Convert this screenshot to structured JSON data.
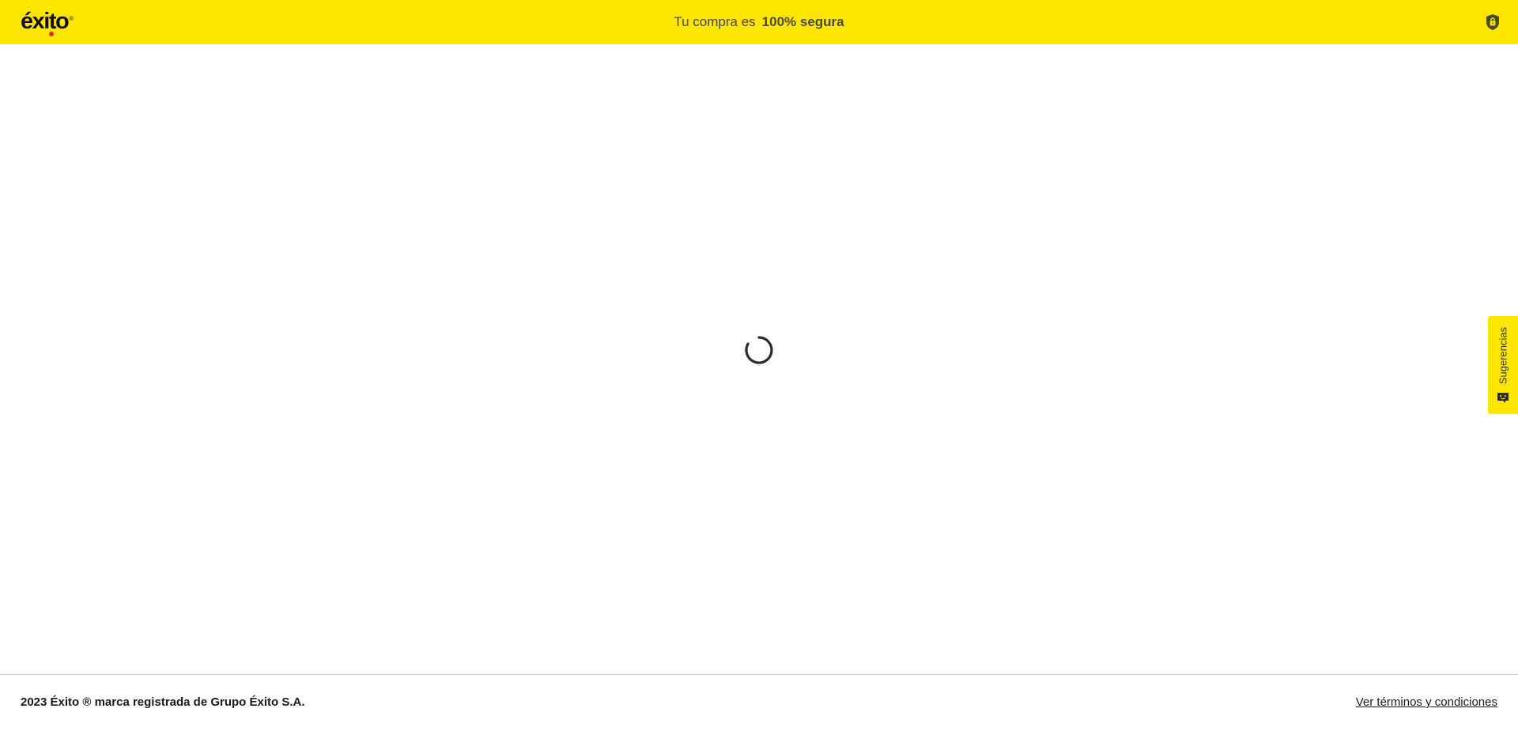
{
  "header": {
    "logo_text": "éxito",
    "logo_mark": "®",
    "secure_prefix": "Tu compra es",
    "secure_emphasis": "100% segura",
    "lock_icon": "shield-lock-icon",
    "background_color": "#ffe600"
  },
  "main": {
    "loading_indicator": "spinner"
  },
  "feedback_tab": {
    "label": "Sugerencias",
    "icon": "feedback-face-icon",
    "background_color": "#ffe600"
  },
  "footer": {
    "copyright": "2023 Éxito ® marca registrada de Grupo Éxito S.A.",
    "terms_link": "Ver términos y condiciones"
  }
}
